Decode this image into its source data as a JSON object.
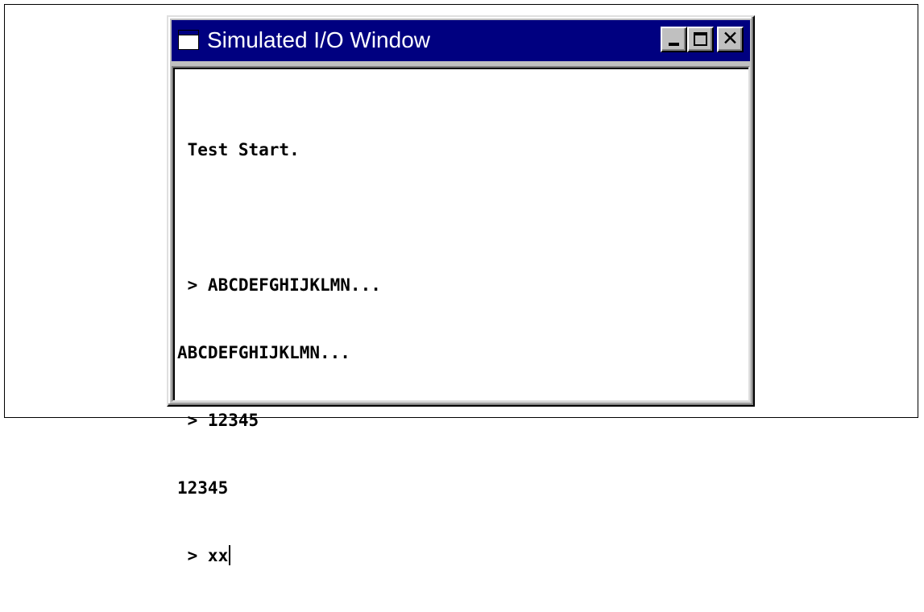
{
  "window": {
    "title": "Simulated I/O Window",
    "icon": "window-icon",
    "controls": {
      "minimize": "minimize-icon",
      "maximize": "maximize-icon",
      "close": "✕"
    }
  },
  "console": {
    "lines": [
      " Test Start.",
      "",
      " > ABCDEFGHIJKLMN...",
      "ABCDEFGHIJKLMN...",
      " > 12345",
      "12345",
      " > xx"
    ]
  }
}
